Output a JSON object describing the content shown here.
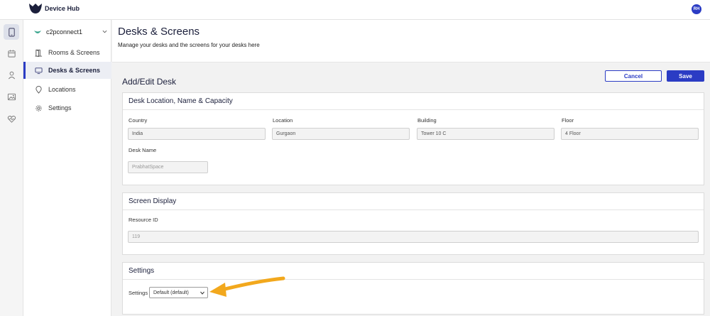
{
  "app": {
    "title": "Device Hub",
    "user_initials": "RH"
  },
  "rail": {
    "items": [
      {
        "icon": "tablet-icon",
        "active": true
      },
      {
        "icon": "calendar-icon",
        "active": false
      },
      {
        "icon": "person-icon",
        "active": false
      },
      {
        "icon": "image-icon",
        "active": false
      },
      {
        "icon": "heart-pulse-icon",
        "active": false
      }
    ]
  },
  "sidebar": {
    "org_name": "c2pconnect1",
    "items": [
      {
        "label": "Rooms & Screens",
        "icon": "door-icon",
        "active": false
      },
      {
        "label": "Desks & Screens",
        "icon": "monitor-icon",
        "active": true
      },
      {
        "label": "Locations",
        "icon": "location-pin-icon",
        "active": false
      },
      {
        "label": "Settings",
        "icon": "gear-icon",
        "active": false
      }
    ]
  },
  "header": {
    "title": "Desks & Screens",
    "subtitle": "Manage your desks and the screens for your desks here"
  },
  "main": {
    "section_title": "Add/Edit Desk",
    "cancel_label": "Cancel",
    "save_label": "Save",
    "location_card": {
      "title": "Desk Location, Name & Capacity",
      "country_label": "Country",
      "country_value": "India",
      "location_label": "Location",
      "location_value": "Gurgaon",
      "building_label": "Building",
      "building_value": "Tower 10 C",
      "floor_label": "Floor",
      "floor_value": "4 Floor",
      "desk_name_label": "Desk Name",
      "desk_name_placeholder": "PrabhatSpace"
    },
    "screen_card": {
      "title": "Screen Display",
      "resource_label": "Resource ID",
      "resource_placeholder": "119"
    },
    "settings_card": {
      "title": "Settings",
      "settings_label": "Settings",
      "settings_selected": "Default (default)"
    }
  },
  "colors": {
    "accent": "#2b3cc4",
    "annotation_arrow": "#f2a81d",
    "brand_dark": "#1b1f3b"
  }
}
